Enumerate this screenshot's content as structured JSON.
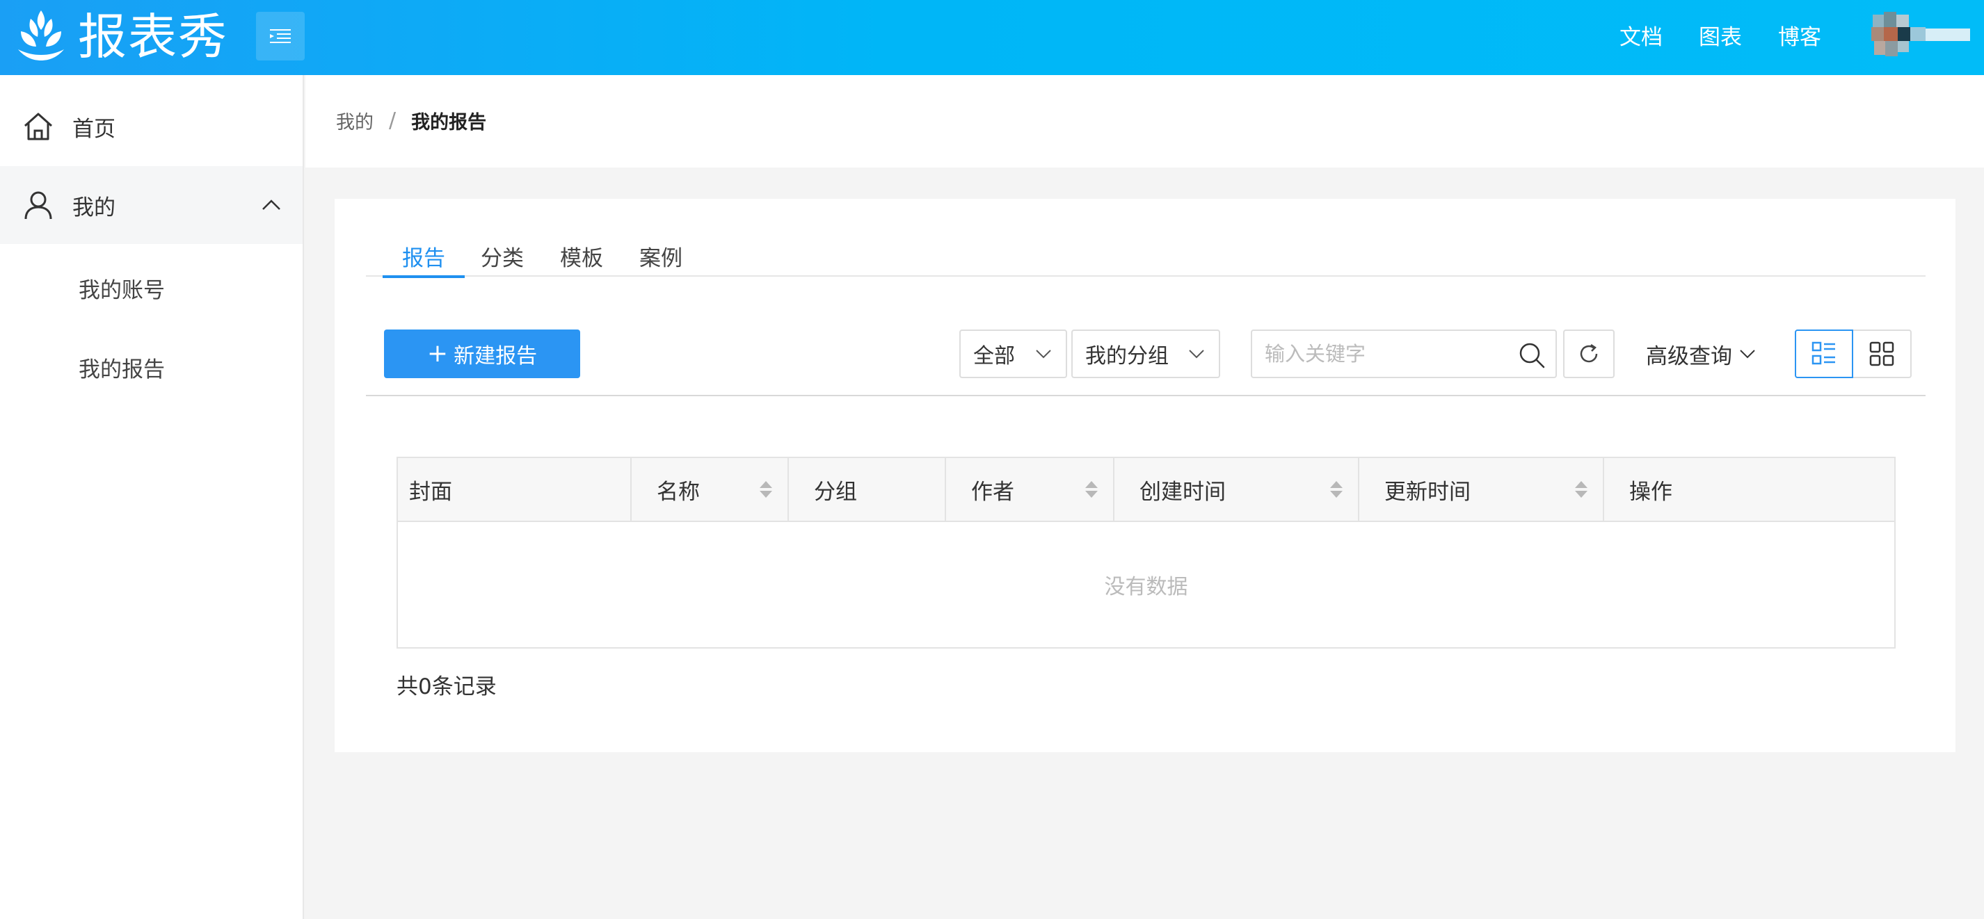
{
  "app": {
    "title": "报表秀"
  },
  "header": {
    "links": [
      {
        "label": "文档"
      },
      {
        "label": "图表"
      },
      {
        "label": "博客"
      }
    ]
  },
  "sidebar": {
    "items": [
      {
        "label": "首页"
      },
      {
        "label": "我的"
      }
    ],
    "subitems": [
      {
        "label": "我的账号"
      },
      {
        "label": "我的报告"
      }
    ]
  },
  "breadcrumb": {
    "parent": "我的",
    "separator": "/",
    "current": "我的报告"
  },
  "tabs": [
    {
      "label": "报告"
    },
    {
      "label": "分类"
    },
    {
      "label": "模板"
    },
    {
      "label": "案例"
    }
  ],
  "toolbar": {
    "new_button": "新建报告",
    "filter_scope": "全部",
    "filter_group": "我的分组",
    "search_placeholder": "输入关键字",
    "advanced_query": "高级查询"
  },
  "table": {
    "columns": [
      {
        "label": "封面"
      },
      {
        "label": "名称"
      },
      {
        "label": "分组"
      },
      {
        "label": "作者"
      },
      {
        "label": "创建时间"
      },
      {
        "label": "更新时间"
      },
      {
        "label": "操作"
      }
    ],
    "empty_text": "没有数据",
    "total_text": "共0条记录"
  },
  "colors": {
    "accent": "#2b95f3",
    "header_start": "#1a9ff5",
    "header_end": "#01bcf8"
  }
}
